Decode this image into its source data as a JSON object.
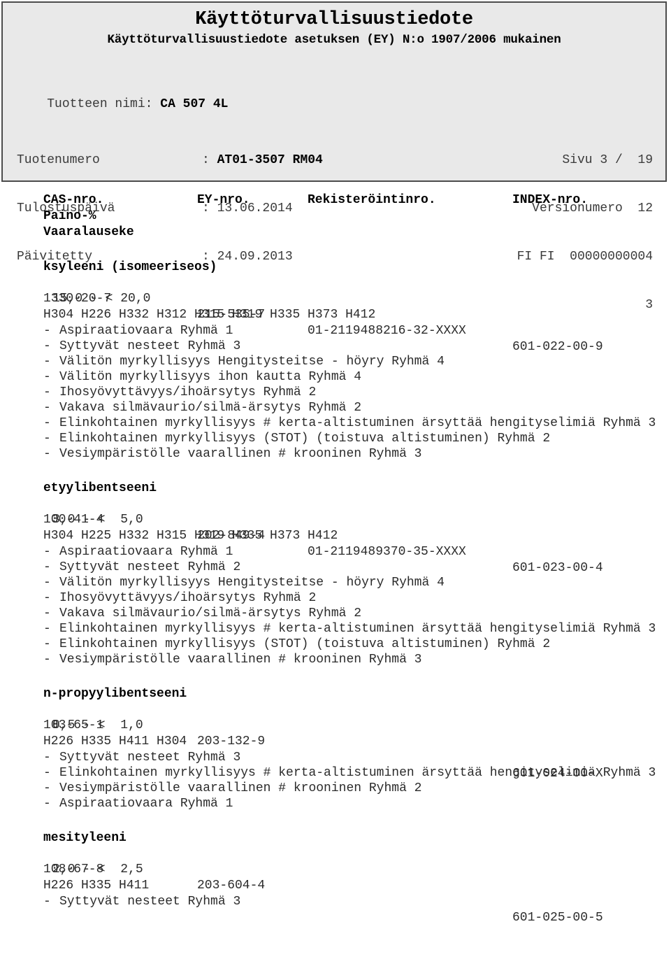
{
  "header": {
    "title": "Käyttöturvallisuustiedote",
    "subtitle": "Käyttöturvallisuustiedote asetuksen (EY) N:o 1907/2006 mukainen",
    "product_label": "Tuotteen nimi:",
    "product_value": "CA 507 4L",
    "meta_left": [
      {
        "key": "Tuotenumero",
        "sep": ":",
        "value": "AT01-3507 RM04",
        "bold": true
      },
      {
        "key": "Tulostuspäivä",
        "sep": ":",
        "value": "13.06.2014",
        "bold": false
      },
      {
        "key": "Päivitetty",
        "sep": ":",
        "value": "24.09.2013",
        "bold": false
      }
    ],
    "meta_right": [
      "Sivu 3 /  19",
      "Versionumero  12",
      "FI FI  00000000004",
      "3"
    ]
  },
  "columns": {
    "cas": "CAS-nro.",
    "ey": "EY-nro.",
    "reg": "Rekisteröintinro.",
    "index": "INDEX-nro.",
    "weight": "Paino-%",
    "hazard": "Vaaralauseke"
  },
  "substances": [
    {
      "name": "ksyleeni (isomeeriseos)",
      "cas": "1330-20-7",
      "ey": "215-535-7",
      "reg": "01-2119488216-32-XXXX",
      "index": "601-022-00-9",
      "weight": "15,0 - < 20,0",
      "hcodes": "H304 H226 H332 H312 H315 H319 H335 H373 H412",
      "hazards": [
        "Aspiraatiovaara Ryhmä 1",
        "Syttyvät nesteet Ryhmä 3",
        "Välitön myrkyllisyys Hengitysteitse - höyry Ryhmä 4",
        "Välitön myrkyllisyys ihon kautta Ryhmä 4",
        "Ihosyövyttävyys/ihoärsytys Ryhmä 2",
        "Vakava silmävaurio/silmä-ärsytys Ryhmä 2",
        "Elinkohtainen myrkyllisyys # kerta-altistuminen ärsyttää hengityselimiä Ryhmä 3",
        "Elinkohtainen myrkyllisyys (STOT) (toistuva altistuminen) Ryhmä 2",
        "Vesiympäristölle vaarallinen # krooninen Ryhmä 3"
      ]
    },
    {
      "name": "etyylibentseeni",
      "cas": "100-41-4",
      "ey": "202-849-4",
      "reg": "01-2119489370-35-XXXX",
      "index": "601-023-00-4",
      "weight": "3,0 - <  5,0",
      "hcodes": "H304 H225 H332 H315 H319 H335 H373 H412",
      "hazards": [
        "Aspiraatiovaara Ryhmä 1",
        "Syttyvät nesteet Ryhmä 2",
        "Välitön myrkyllisyys Hengitysteitse - höyry Ryhmä 4",
        "Ihosyövyttävyys/ihoärsytys Ryhmä 2",
        "Vakava silmävaurio/silmä-ärsytys Ryhmä 2",
        "Elinkohtainen myrkyllisyys # kerta-altistuminen ärsyttää hengityselimiä Ryhmä 3",
        "Elinkohtainen myrkyllisyys (STOT) (toistuva altistuminen) Ryhmä 2",
        "Vesiympäristölle vaarallinen # krooninen Ryhmä 3"
      ]
    },
    {
      "name": "n-propyylibentseeni",
      "cas": "103-65-1",
      "ey": "203-132-9",
      "reg": "",
      "index": "601-024-00-X",
      "weight": "0,5 - <  1,0",
      "hcodes": "H226 H335 H411 H304",
      "hazards": [
        "Syttyvät nesteet Ryhmä 3",
        "Elinkohtainen myrkyllisyys # kerta-altistuminen ärsyttää hengityselimiä Ryhmä 3",
        "Vesiympäristölle vaarallinen # krooninen Ryhmä 2",
        "Aspiraatiovaara Ryhmä 1"
      ]
    },
    {
      "name": "mesityleeni",
      "cas": "108-67-8",
      "ey": "203-604-4",
      "reg": "",
      "index": "601-025-00-5",
      "weight": "2,0 - <  2,5",
      "hcodes": "H226 H335 H411",
      "hazards": [
        "Syttyvät nesteet Ryhmä 3"
      ]
    }
  ]
}
